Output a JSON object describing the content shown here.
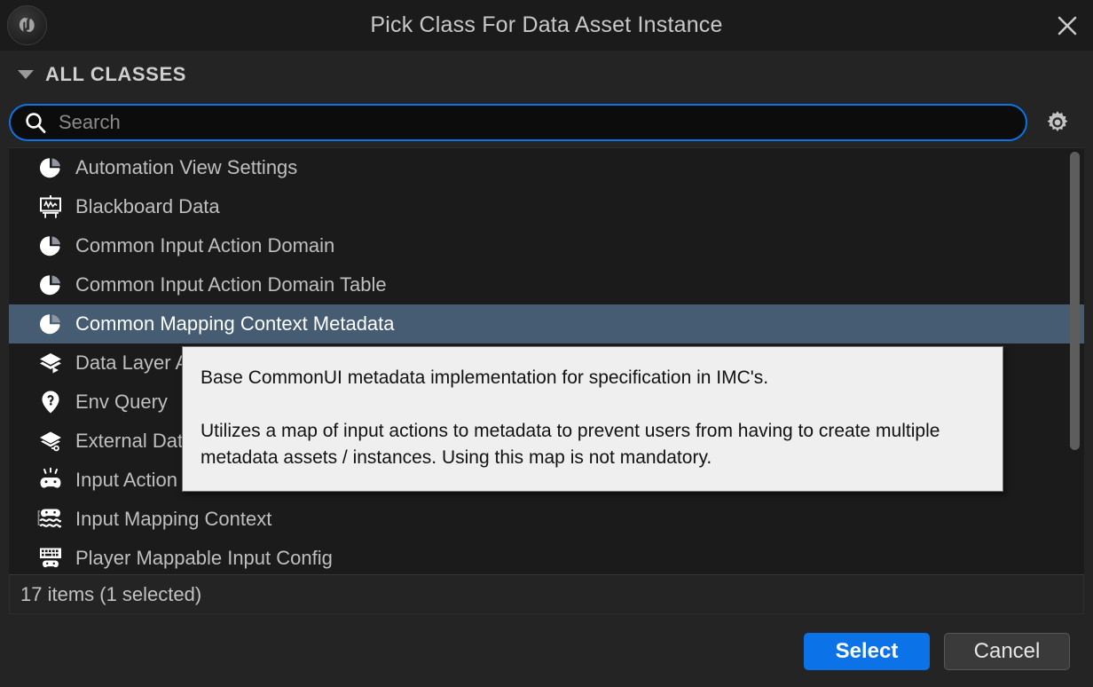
{
  "window": {
    "title": "Pick Class For Data Asset Instance",
    "logo_name": "unreal-engine-logo",
    "close_label": "×"
  },
  "section": {
    "title": "ALL CLASSES",
    "expanded": true
  },
  "search": {
    "placeholder": "Search",
    "value": "",
    "icon": "search-icon",
    "settings_icon": "gear-icon",
    "focus_color": "#0c72e8"
  },
  "list": {
    "selected_index": 4,
    "selection_color": "#455c73",
    "items": [
      {
        "label": "Automation View Settings",
        "icon": "data-asset-icon"
      },
      {
        "label": "Blackboard Data",
        "icon": "blackboard-icon"
      },
      {
        "label": "Common Input Action Domain",
        "icon": "data-asset-icon"
      },
      {
        "label": "Common Input Action Domain Table",
        "icon": "data-asset-icon"
      },
      {
        "label": "Common Mapping Context Metadata",
        "icon": "data-asset-icon"
      },
      {
        "label": "Data Layer Asset",
        "icon": "data-layer-icon"
      },
      {
        "label": "Env Query",
        "icon": "env-query-icon"
      },
      {
        "label": "External Data Layer Asset",
        "icon": "external-data-layer-icon"
      },
      {
        "label": "Input Action",
        "icon": "input-action-icon"
      },
      {
        "label": "Input Mapping Context",
        "icon": "input-mapping-context-icon"
      },
      {
        "label": "Player Mappable Input Config",
        "icon": "player-mappable-input-config-icon"
      }
    ]
  },
  "scrollbar": {
    "thumb_top_pct": 1,
    "thumb_height_pct": 70
  },
  "status": {
    "text": "17 items (1 selected)",
    "item_count": 17,
    "selected_count": 1
  },
  "tooltip": {
    "paragraph1": "Base CommonUI metadata implementation for specification in IMC's.",
    "paragraph2": "Utilizes a map of input actions to metadata to prevent users from having to create multiple metadata assets / instances. Using this map is not mandatory."
  },
  "footer": {
    "select_label": "Select",
    "cancel_label": "Cancel",
    "primary_color": "#0c72e8"
  }
}
